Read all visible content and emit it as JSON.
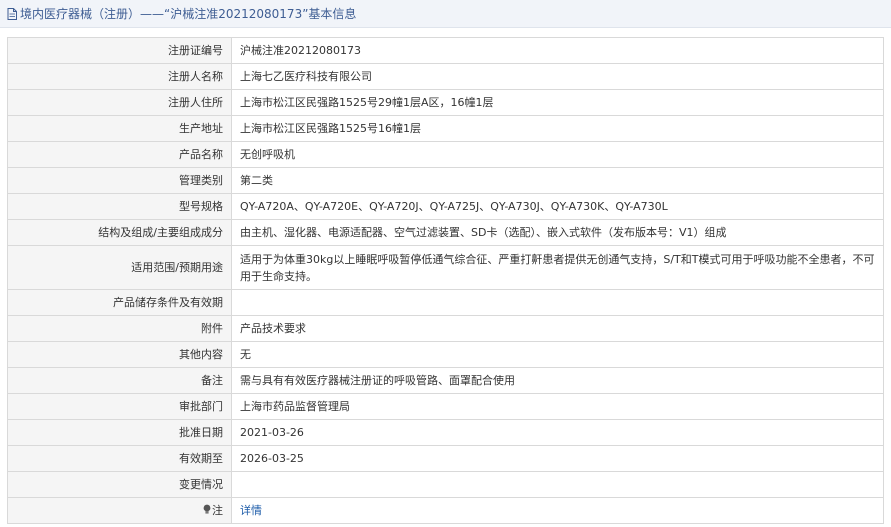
{
  "header": {
    "title": "境内医疗器械（注册）——“沪械注准20212080173”基本信息",
    "icon": "document-icon"
  },
  "rows": [
    {
      "label": "注册证编号",
      "value": "沪械注准20212080173"
    },
    {
      "label": "注册人名称",
      "value": "上海七乙医疗科技有限公司"
    },
    {
      "label": "注册人住所",
      "value": "上海市松江区民强路1525号29幢1层A区，16幢1层"
    },
    {
      "label": "生产地址",
      "value": "上海市松江区民强路1525号16幢1层"
    },
    {
      "label": "产品名称",
      "value": "无创呼吸机"
    },
    {
      "label": "管理类别",
      "value": "第二类"
    },
    {
      "label": "型号规格",
      "value": "QY-A720A、QY-A720E、QY-A720J、QY-A725J、QY-A730J、QY-A730K、QY-A730L"
    },
    {
      "label": "结构及组成/主要组成成分",
      "value": "由主机、湿化器、电源适配器、空气过滤装置、SD卡（选配）、嵌入式软件（发布版本号：V1）组成"
    },
    {
      "label": "适用范围/预期用途",
      "value": "适用于为体重30kg以上睡眠呼吸暂停低通气综合征、严重打鼾患者提供无创通气支持，S/T和T模式可用于呼吸功能不全患者，不可用于生命支持。"
    },
    {
      "label": "产品储存条件及有效期",
      "value": ""
    },
    {
      "label": "附件",
      "value": "产品技术要求"
    },
    {
      "label": "其他内容",
      "value": "无"
    },
    {
      "label": "备注",
      "value": "需与具有有效医疗器械注册证的呼吸管路、面罩配合使用"
    },
    {
      "label": "审批部门",
      "value": "上海市药品监督管理局"
    },
    {
      "label": "批准日期",
      "value": "2021-03-26"
    },
    {
      "label": "有效期至",
      "value": "2026-03-25"
    },
    {
      "label": "变更情况",
      "value": ""
    }
  ],
  "note_row": {
    "label": "注",
    "icon": "light-bulb-icon",
    "link_text": "详情"
  },
  "colors": {
    "title_text": "#3e5d93",
    "title_bg": "#f1f4f9",
    "label_bg": "#f5f5f5",
    "border": "#d9d9d9",
    "link": "#1a5aa8"
  }
}
